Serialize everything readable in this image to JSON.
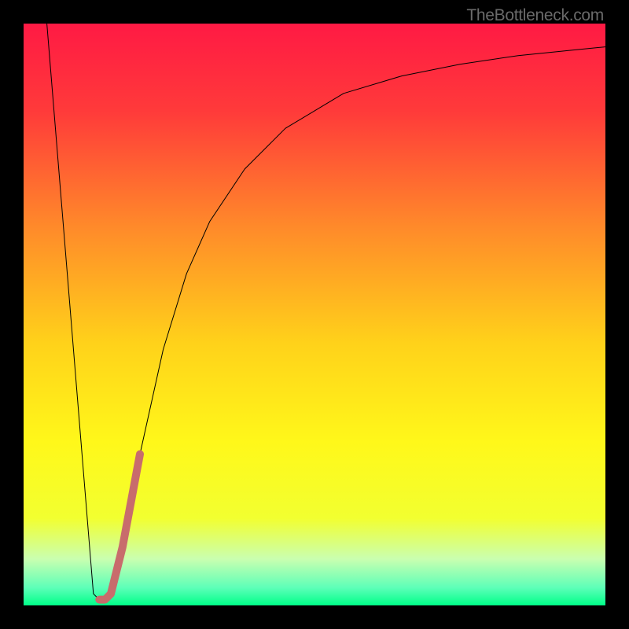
{
  "watermark": "TheBottleneck.com",
  "chart_data": {
    "type": "line",
    "title": "",
    "xlabel": "",
    "ylabel": "",
    "x_range": [
      0,
      100
    ],
    "y_range": [
      0,
      100
    ],
    "series": [
      {
        "name": "main-curve",
        "color": "#000000",
        "stroke_width": 1,
        "points": [
          {
            "x": 4,
            "y": 100
          },
          {
            "x": 12,
            "y": 2
          },
          {
            "x": 13,
            "y": 1
          },
          {
            "x": 14,
            "y": 1
          },
          {
            "x": 15,
            "y": 2
          },
          {
            "x": 17,
            "y": 10
          },
          {
            "x": 20,
            "y": 26
          },
          {
            "x": 24,
            "y": 44
          },
          {
            "x": 28,
            "y": 57
          },
          {
            "x": 32,
            "y": 66
          },
          {
            "x": 38,
            "y": 75
          },
          {
            "x": 45,
            "y": 82
          },
          {
            "x": 55,
            "y": 88
          },
          {
            "x": 65,
            "y": 91
          },
          {
            "x": 75,
            "y": 93
          },
          {
            "x": 85,
            "y": 94.5
          },
          {
            "x": 95,
            "y": 95.5
          },
          {
            "x": 100,
            "y": 96
          }
        ]
      },
      {
        "name": "highlight-segment",
        "color": "#c86c6c",
        "stroke_width": 10,
        "points": [
          {
            "x": 13,
            "y": 1
          },
          {
            "x": 14,
            "y": 1
          },
          {
            "x": 15,
            "y": 2
          },
          {
            "x": 17,
            "y": 10
          },
          {
            "x": 20,
            "y": 26
          }
        ]
      }
    ],
    "background_gradient": {
      "type": "vertical",
      "stops": [
        {
          "offset": 0,
          "color": "#ff1a44"
        },
        {
          "offset": 0.15,
          "color": "#ff3a3a"
        },
        {
          "offset": 0.35,
          "color": "#ff8a2a"
        },
        {
          "offset": 0.55,
          "color": "#ffd21a"
        },
        {
          "offset": 0.72,
          "color": "#fff81a"
        },
        {
          "offset": 0.85,
          "color": "#f2ff30"
        },
        {
          "offset": 0.92,
          "color": "#caffb0"
        },
        {
          "offset": 0.97,
          "color": "#5cffb8"
        },
        {
          "offset": 1.0,
          "color": "#00ff88"
        }
      ]
    }
  }
}
